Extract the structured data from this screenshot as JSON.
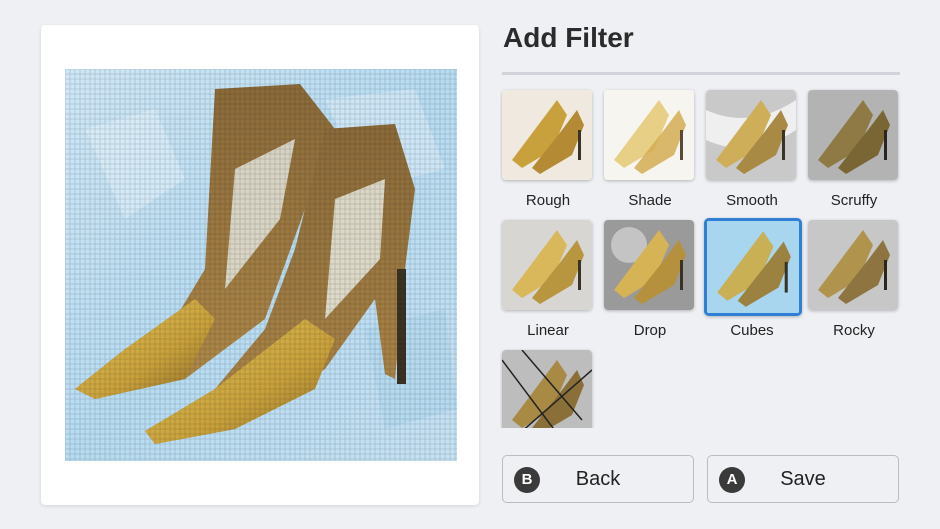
{
  "panel": {
    "title": "Add Filter"
  },
  "preview": {
    "description_icon": "pixelated-heels-preview",
    "applied_filter": "Cubes"
  },
  "filters": [
    {
      "label": "Rough",
      "selected": false,
      "bg": "#efe9df"
    },
    {
      "label": "Shade",
      "selected": false,
      "bg": "#f7f5f0"
    },
    {
      "label": "Smooth",
      "selected": false,
      "bg": "#c9c9c9"
    },
    {
      "label": "Scruffy",
      "selected": false,
      "bg": "#b3b3b3"
    },
    {
      "label": "Linear",
      "selected": false,
      "bg": "#d8d6d2"
    },
    {
      "label": "Drop",
      "selected": false,
      "bg": "#9a9a9a"
    },
    {
      "label": "Cubes",
      "selected": true,
      "bg": "#a9d6ef"
    },
    {
      "label": "Rocky",
      "selected": false,
      "bg": "#c7c7c7"
    },
    {
      "label": "",
      "selected": false,
      "bg": "#bdbdbd"
    }
  ],
  "buttons": {
    "back": {
      "badge": "B",
      "label": "Back"
    },
    "save": {
      "badge": "A",
      "label": "Save"
    }
  },
  "colors": {
    "accent": "#2f7fd6",
    "background": "#eef0f4",
    "shoe": "#c9a74a"
  }
}
